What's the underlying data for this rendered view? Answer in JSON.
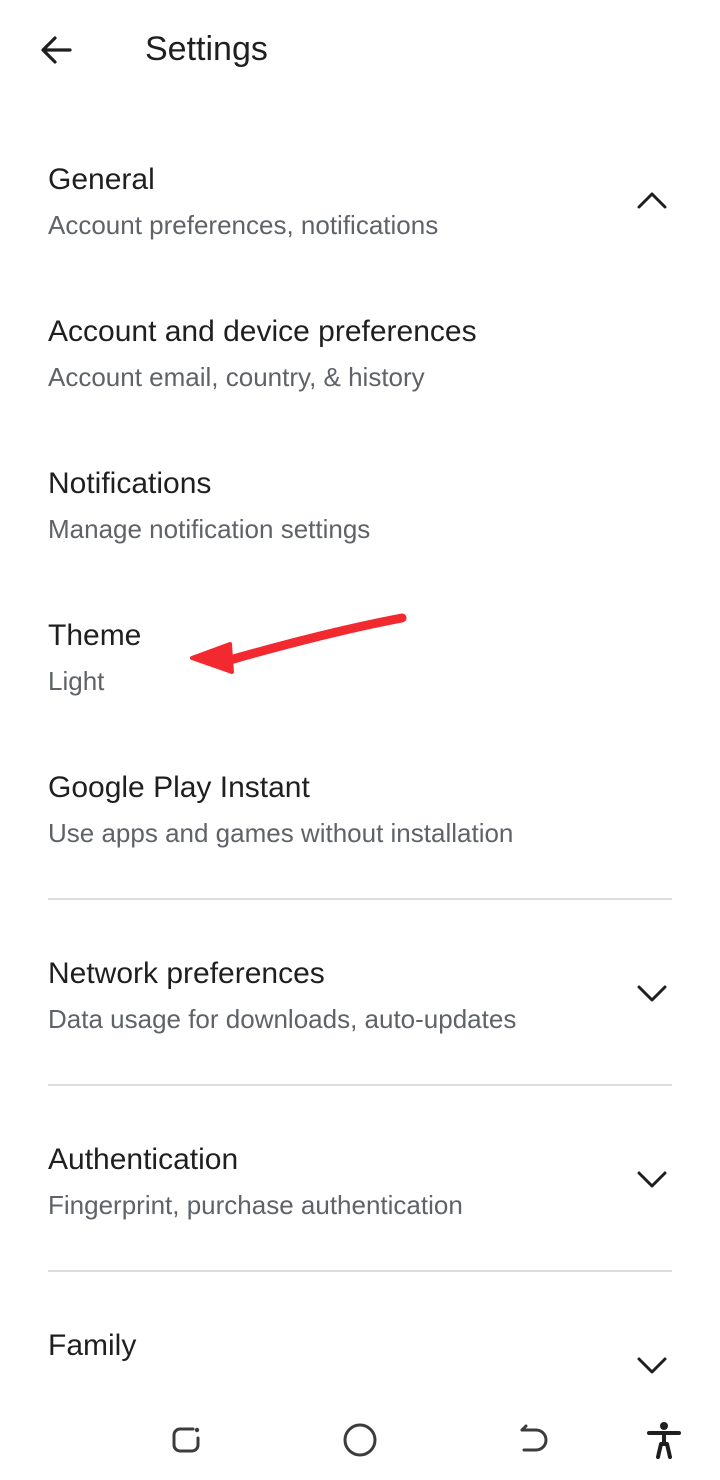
{
  "header": {
    "title": "Settings",
    "back_icon": "arrow-left-icon"
  },
  "settings": {
    "general": {
      "title": "General",
      "subtitle": "Account preferences, notifications",
      "chevron": "chevron-up-icon"
    },
    "account": {
      "title": "Account and device preferences",
      "subtitle": "Account email, country, & history"
    },
    "notifications": {
      "title": "Notifications",
      "subtitle": "Manage notification settings"
    },
    "theme": {
      "title": "Theme",
      "subtitle": "Light"
    },
    "instant": {
      "title": "Google Play Instant",
      "subtitle": "Use apps and games without installation"
    },
    "network": {
      "title": "Network preferences",
      "subtitle": "Data usage for downloads, auto-updates",
      "chevron": "chevron-down-icon"
    },
    "authentication": {
      "title": "Authentication",
      "subtitle": "Fingerprint, purchase authentication",
      "chevron": "chevron-down-icon"
    },
    "family": {
      "title": "Family",
      "chevron": "chevron-down-icon"
    }
  },
  "nav_bar": {
    "icons": [
      "recents-icon",
      "home-icon",
      "back-icon",
      "accessibility-icon"
    ]
  },
  "colors": {
    "primary_text": "#1f1f1f",
    "secondary_text": "#5f6368",
    "divider": "#dcdcdc",
    "annotation_arrow": "#f2292f"
  }
}
